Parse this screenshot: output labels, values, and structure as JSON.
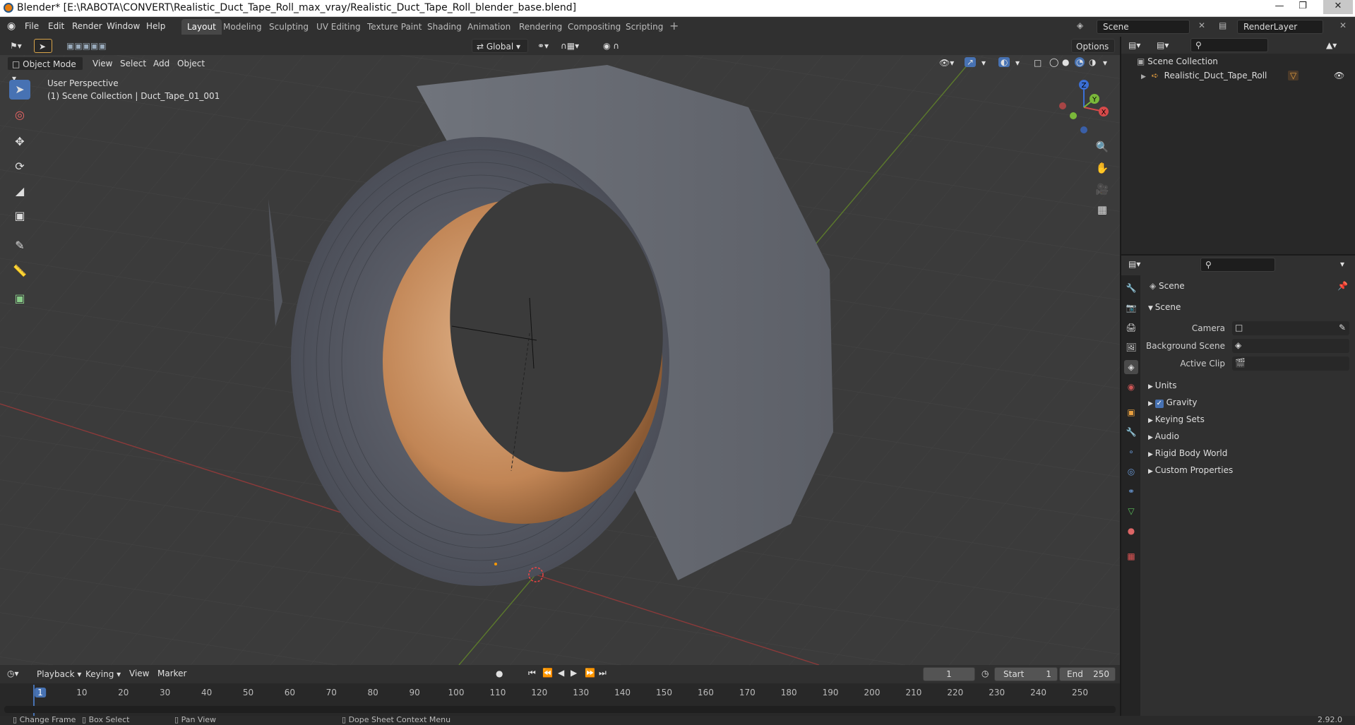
{
  "window": {
    "title": "Blender* [E:\\RABOTA\\CONVERT\\Realistic_Duct_Tape_Roll_max_vray/Realistic_Duct_Tape_Roll_blender_base.blend]"
  },
  "menu": {
    "file": "File",
    "edit": "Edit",
    "render": "Render",
    "window": "Window",
    "help": "Help"
  },
  "workspaces": [
    "Layout",
    "Modeling",
    "Sculpting",
    "UV Editing",
    "Texture Paint",
    "Shading",
    "Animation",
    "Rendering",
    "Compositing",
    "Scripting"
  ],
  "scene_selector": {
    "scene": "Scene",
    "render_layer": "RenderLayer"
  },
  "viewport_header": {
    "mode": "Object Mode",
    "view": "View",
    "select": "Select",
    "add": "Add",
    "object": "Object",
    "transform_orientation": "Global",
    "options": "Options"
  },
  "viewport": {
    "perspective": "User Perspective",
    "collection_info": "(1) Scene Collection | Duct_Tape_01_001",
    "gizmo": {
      "x": "X",
      "y": "Y",
      "z": "Z"
    }
  },
  "outliner": {
    "root": "Scene Collection",
    "items": [
      {
        "label": "Realistic_Duct_Tape_Roll"
      }
    ]
  },
  "properties": {
    "context": "Scene",
    "panel_title": "Scene",
    "fields": [
      {
        "label": "Camera"
      },
      {
        "label": "Background Scene"
      },
      {
        "label": "Active Clip"
      }
    ],
    "panels": [
      "Units",
      "Gravity",
      "Keying Sets",
      "Audio",
      "Rigid Body World",
      "Custom Properties"
    ],
    "gravity_checked": true
  },
  "timeline": {
    "playback": "Playback",
    "keying": "Keying",
    "view": "View",
    "marker": "Marker",
    "current_frame": "1",
    "start_label": "Start",
    "start": "1",
    "end_label": "End",
    "end": "250",
    "ticks": [
      "1",
      "10",
      "20",
      "30",
      "40",
      "50",
      "60",
      "70",
      "80",
      "90",
      "100",
      "110",
      "120",
      "130",
      "140",
      "150",
      "160",
      "170",
      "180",
      "190",
      "200",
      "210",
      "220",
      "230",
      "240",
      "250"
    ]
  },
  "statusbar": {
    "items": [
      "Change Frame",
      "Box Select",
      "Pan View",
      "Dope Sheet Context Menu"
    ],
    "version": "2.92.0"
  },
  "colors": {
    "accent": "#4772b3",
    "header": "#303030",
    "viewport_bg": "#3b3b3b",
    "tape": "#5a5d66",
    "core": "#c48a5a"
  }
}
